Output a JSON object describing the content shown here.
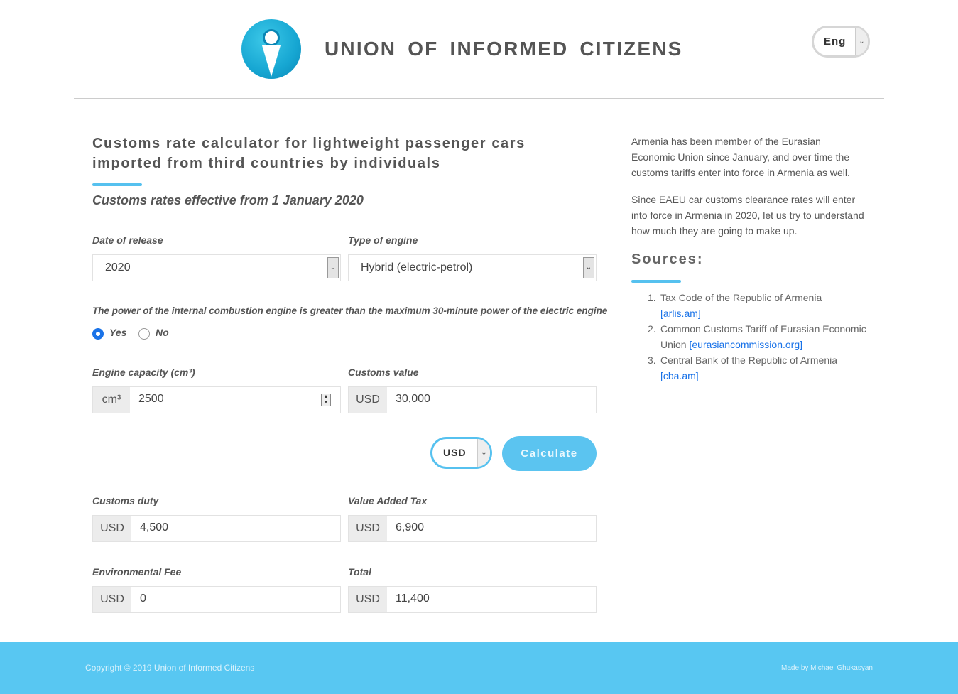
{
  "header": {
    "brand": "UNION OF INFORMED CITIZENS",
    "language": "Eng"
  },
  "main": {
    "title": "Customs rate calculator for lightweight passenger cars imported from third countries by individuals",
    "subtitle": "Customs rates effective from 1 January 2020",
    "date_label": "Date of release",
    "date_value": "2020",
    "engine_label": "Type of engine",
    "engine_value": "Hybrid (electric-petrol)",
    "power_question": "The power of the internal combustion engine is greater than the maximum 30-minute power of the electric engine",
    "radio_yes": "Yes",
    "radio_no": "No",
    "radio_selected": "Yes",
    "capacity_label": "Engine capacity (cm³)",
    "capacity_unit": "cm³",
    "capacity_value": "2500",
    "customs_value_label": "Customs value",
    "customs_value_currency": "USD",
    "customs_value": "30,000",
    "currency_select": "USD",
    "calculate_label": "Calculate",
    "results": {
      "duty_label": "Customs duty",
      "duty_currency": "USD",
      "duty_value": "4,500",
      "vat_label": "Value Added Tax",
      "vat_currency": "USD",
      "vat_value": "6,900",
      "env_label": "Environmental Fee",
      "env_currency": "USD",
      "env_value": "0",
      "total_label": "Total",
      "total_currency": "USD",
      "total_value": "11,400"
    }
  },
  "sidebar": {
    "paragraph1": "Armenia has been member of the Eurasian Economic Union since January, and over time the customs tariffs enter into force in Armenia as well.",
    "paragraph2": "Since EAEU car customs clearance rates will enter into force in Armenia in 2020, let us try to understand how much they are going to make up.",
    "sources_heading": "Sources:",
    "sources": [
      {
        "num": "1.",
        "text": "Tax Code of the Republic of Armenia",
        "link": "[arlis.am]"
      },
      {
        "num": "2.",
        "text": "Common Customs Tariff of Eurasian Economic Union",
        "link": "[eurasiancommission.org]"
      },
      {
        "num": "3.",
        "text": "Central Bank of the Republic of Armenia",
        "link": "[cba.am]"
      }
    ]
  },
  "footer": {
    "copyright": "Copyright © 2019 Union of Informed Citizens",
    "made_by": "Made by Michael Ghukasyan"
  },
  "colors": {
    "accent": "#56c1ef",
    "footer_bg": "#58c7f2",
    "link": "#1a73e8",
    "radio_selected": "#1a73e8"
  }
}
